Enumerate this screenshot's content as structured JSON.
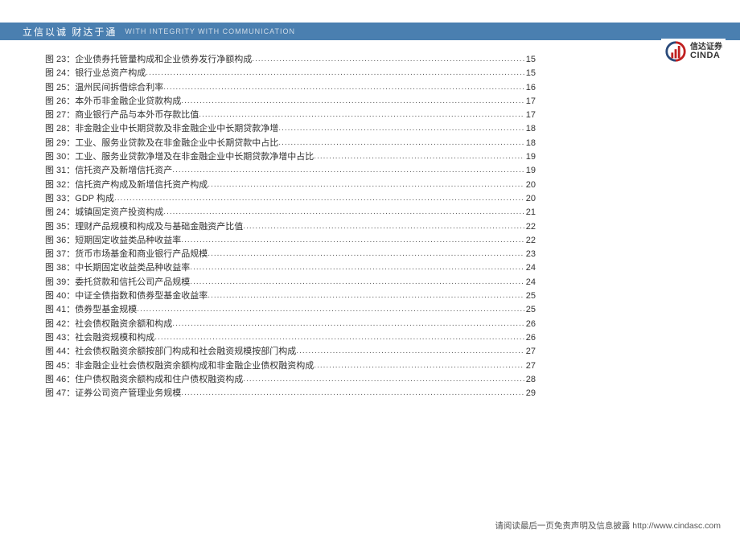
{
  "header": {
    "cn": "立信以诚  财达于通",
    "en": "WITH INTEGRITY  WITH COMMUNICATION"
  },
  "logo": {
    "cn": "信达证券",
    "en": "CINDA"
  },
  "toc": [
    {
      "label": "图 23：",
      "title": "企业债券托管量构成和企业债券发行净额构成",
      "page": "15"
    },
    {
      "label": "图 24：",
      "title": "银行业总资产构成",
      "page": "15"
    },
    {
      "label": "图 25：",
      "title": "温州民间拆借综合利率",
      "page": "16"
    },
    {
      "label": "图 26：",
      "title": "本外币非金融企业贷款构成",
      "page": "17"
    },
    {
      "label": "图 27：",
      "title": "商业银行产品与本外币存款比值",
      "page": "17"
    },
    {
      "label": "图 28：",
      "title": "非金融企业中长期贷款及非金融企业中长期贷款净增",
      "page": "18"
    },
    {
      "label": "图 29：",
      "title": "工业、服务业贷款及在非金融企业中长期贷款中占比",
      "page": "18"
    },
    {
      "label": "图 30：",
      "title": "工业、服务业贷款净增及在非金融企业中长期贷款净增中占比",
      "page": "19"
    },
    {
      "label": "图 31：",
      "title": "信托资产及新增信托资产",
      "page": "19"
    },
    {
      "label": "图 32：",
      "title": "信托资产构成及新增信托资产构成",
      "page": "20"
    },
    {
      "label": "图 33：",
      "title": "GDP 构成",
      "page": "20"
    },
    {
      "label": "图 24：",
      "title": "城镇固定资产投资构成",
      "page": "21"
    },
    {
      "label": "图 35：",
      "title": "理财产品规模和构成及与基础金融资产比值",
      "page": "22"
    },
    {
      "label": "图 36：",
      "title": "短期固定收益类品种收益率",
      "page": "22"
    },
    {
      "label": "图 37：",
      "title": "货币市场基金和商业银行产品规模",
      "page": "23"
    },
    {
      "label": "图 38：",
      "title": "中长期固定收益类品种收益率",
      "page": "24"
    },
    {
      "label": "图 39：",
      "title": "委托贷款和信托公司产品规模",
      "page": "24"
    },
    {
      "label": "图 40：",
      "title": "中证全债指数和债券型基金收益率",
      "page": "25"
    },
    {
      "label": "图 41：",
      "title": "债券型基金规模",
      "page": "25"
    },
    {
      "label": "图 42：",
      "title": "社会债权融资余额和构成",
      "page": "26"
    },
    {
      "label": "图 43：",
      "title": "社会融资规模和构成",
      "page": "26"
    },
    {
      "label": "图 44：",
      "title": "社会债权融资余额按部门构成和社会融资规模按部门构成",
      "page": "27"
    },
    {
      "label": "图 45：",
      "title": "非金融企业社会债权融资余额构成和非金融企业债权融资构成",
      "page": "27"
    },
    {
      "label": "图 46：",
      "title": "住户债权融资余额构成和住户债权融资构成",
      "page": "28"
    },
    {
      "label": "图 47：",
      "title": "证券公司资产管理业务规模",
      "page": "29"
    }
  ],
  "footer": {
    "text": "请阅读最后一页免责声明及信息披露",
    "url": "http://www.cindasc.com"
  }
}
